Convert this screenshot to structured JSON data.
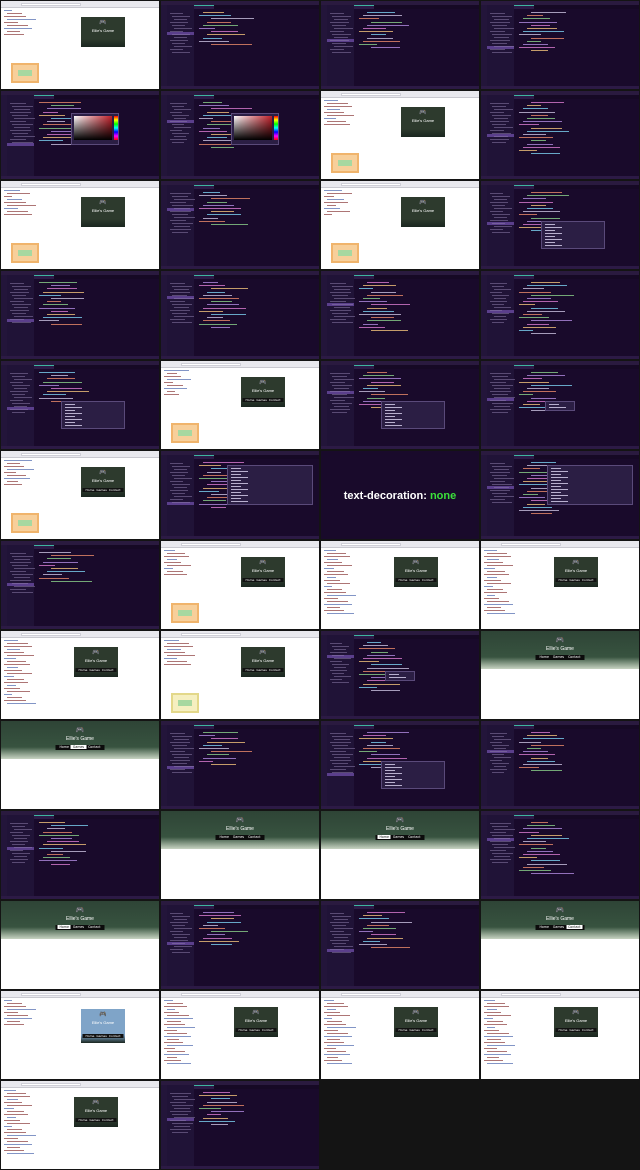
{
  "sheet": {
    "columns": 4,
    "rows": 13,
    "tile_count": 50
  },
  "card": {
    "title": "Ellie's Game",
    "nav_items": [
      "Home",
      "Games",
      "Contact"
    ]
  },
  "callout": {
    "property": "text-decoration:",
    "value": "none"
  },
  "controller_glyph": "🎮",
  "colors": {
    "editor_bg": "#190a2b",
    "editor_sidebar": "#201337",
    "accent_teal": "#3db5a0",
    "card_bg": "#2d3a2d",
    "highlight_green": "#3be03b"
  },
  "tiles": [
    {
      "type": "browser",
      "variant": "box"
    },
    {
      "type": "editor",
      "popup": "none"
    },
    {
      "type": "editor",
      "popup": "none"
    },
    {
      "type": "editor",
      "popup": "none"
    },
    {
      "type": "editor",
      "popup": "picker"
    },
    {
      "type": "editor",
      "popup": "picker"
    },
    {
      "type": "browser",
      "variant": "box"
    },
    {
      "type": "editor",
      "popup": "none"
    },
    {
      "type": "browser",
      "variant": "box"
    },
    {
      "type": "editor",
      "popup": "none"
    },
    {
      "type": "browser",
      "variant": "box"
    },
    {
      "type": "editor",
      "popup": "list"
    },
    {
      "type": "editor",
      "popup": "none"
    },
    {
      "type": "editor",
      "popup": "none"
    },
    {
      "type": "editor",
      "popup": "none"
    },
    {
      "type": "editor",
      "popup": "none"
    },
    {
      "type": "editor",
      "popup": "list"
    },
    {
      "type": "browser",
      "variant": "box-navbar"
    },
    {
      "type": "editor",
      "popup": "list"
    },
    {
      "type": "editor",
      "popup": "small"
    },
    {
      "type": "browser",
      "variant": "box-navbar"
    },
    {
      "type": "editor",
      "popup": "wide"
    },
    {
      "type": "callout"
    },
    {
      "type": "editor",
      "popup": "wide"
    },
    {
      "type": "editor",
      "popup": "none"
    },
    {
      "type": "browser",
      "variant": "box-navbar"
    },
    {
      "type": "browser",
      "variant": "devtools"
    },
    {
      "type": "browser",
      "variant": "devtools"
    },
    {
      "type": "browser",
      "variant": "devtools"
    },
    {
      "type": "browser",
      "variant": "box-yellow"
    },
    {
      "type": "editor",
      "popup": "small"
    },
    {
      "type": "hero",
      "active": -1
    },
    {
      "type": "hero",
      "active": 1
    },
    {
      "type": "editor",
      "popup": "none"
    },
    {
      "type": "editor",
      "popup": "list"
    },
    {
      "type": "editor",
      "popup": "none"
    },
    {
      "type": "editor",
      "popup": "none"
    },
    {
      "type": "hero",
      "active": -1
    },
    {
      "type": "hero",
      "active": 0
    },
    {
      "type": "editor",
      "popup": "none"
    },
    {
      "type": "hero",
      "active": 0
    },
    {
      "type": "editor",
      "popup": "none"
    },
    {
      "type": "editor",
      "popup": "none"
    },
    {
      "type": "hero",
      "active": 2
    },
    {
      "type": "browser",
      "variant": "blue"
    },
    {
      "type": "browser",
      "variant": "devtools"
    },
    {
      "type": "browser",
      "variant": "devtools"
    },
    {
      "type": "browser",
      "variant": "devtools"
    },
    {
      "type": "browser",
      "variant": "devtools"
    },
    {
      "type": "editor",
      "popup": "none"
    }
  ]
}
